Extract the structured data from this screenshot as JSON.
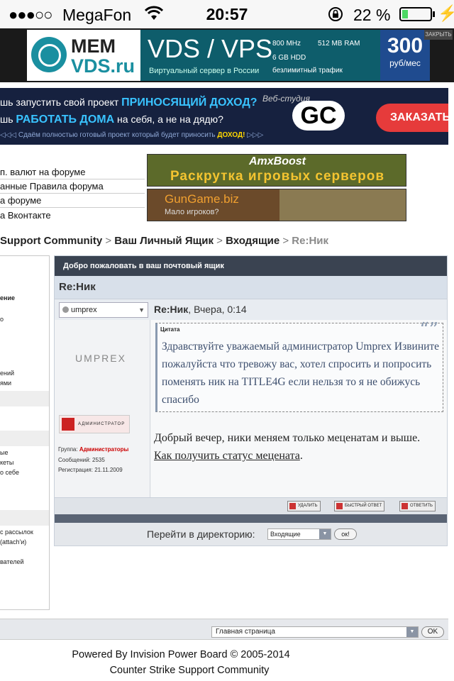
{
  "statusbar": {
    "signal": "●●●○○",
    "carrier": "MegaFon",
    "time": "20:57",
    "battery_pct": "22 %",
    "battery_level": 0.22
  },
  "ad_top": {
    "brand_line1": "MEM",
    "brand_line2": "VDS.ru",
    "headline": "VDS / VPS",
    "subline": "Виртуальный сервер в России",
    "specs": [
      "800 MHz",
      "512 MB RAM",
      "6 GB HDD",
      "безлимитный трафик"
    ],
    "price": "300",
    "price_unit": "руб/мес",
    "close_label": "ЗАКРЫТЬ"
  },
  "ad_gc": {
    "line1_a": "шь запустить свой проект ",
    "line1_b": "ПРИНОСЯЩИЙ ДОХОД?",
    "line2_a": "шь ",
    "line2_b": "РАБОТАТЬ ДОМА",
    "line2_c": " на себя, а не на дядю?",
    "line3_a": "◁◁◁ Сдаём полностью готовый проект который будет приносить ",
    "line3_b": "ДОХОД!",
    "line3_c": " ▷▷▷",
    "studio": "Веб-студия",
    "logo": "GC",
    "order_button": "ЗАКАЗАТЬ"
  },
  "top_links": [
    "п. валют на форуме",
    "анные Правила форума",
    "а форуме",
    "а Вконтакте"
  ],
  "ad_amx": {
    "title": "AmxBoost",
    "subtitle": "Раскрутка игровых серверов"
  },
  "ad_gungame": {
    "title": "GunGame.biz",
    "subtitle": "Мало игроков?"
  },
  "breadcrumb": {
    "items": [
      "Support Community",
      "Ваш Личный Ящик",
      "Входящие"
    ],
    "current": "Re:Ник",
    "separator": ">"
  },
  "sidebar": {
    "items": [
      "ение",
      "о",
      "ений",
      "ями",
      "ые",
      "кеты",
      "о себе",
      "с рассылок",
      "(attach'и)",
      "вателей"
    ]
  },
  "panel": {
    "header": "Добро пожаловать в ваш почтовый ящик",
    "subject": "Re:Ник",
    "author": "umprex",
    "post_title": "Re:Ник",
    "post_time": ", Вчера, 0:14",
    "avatar_text": "UMPREX",
    "group_badge": "АДМИНИСТРАТОР",
    "group_label": "Группа:",
    "group_value": "Администраторы",
    "posts": "Сообщений: 2535",
    "registered": "Регистрация: 21.11.2009",
    "quote_label": "Цитата",
    "quote_mark": "“”",
    "quote_text": "Здравствуйте уважаемый администратор Umprex Извините пожалуйста что тревожу вас, хотел спросить и попросить поменять ник на TITLE4G если нельзя то я не обижусь спасибо",
    "reply_text": "Добрый вечер, ники меняем только меценатам и выше.",
    "reply_link": "Как получить статус мецената",
    "reply_end": ".",
    "buttons": [
      "УДАЛИТЬ",
      "БЫСТРЫЙ ОТВЕТ",
      "ОТВЕТИТЬ"
    ],
    "goto_label": "Перейти в директорию:",
    "goto_value": "Входящие",
    "goto_ok": "ок!"
  },
  "bottom": {
    "select_value": "Главная страница",
    "ok": "OK"
  },
  "footer": {
    "line1": "Powered By Invision Power Board  © 2005-2014",
    "line2": "Counter Strike Support Community"
  },
  "colors": {
    "panel_header": "#3a4351",
    "subject_bar": "#d8e0ea",
    "admin_red": "#cc0000",
    "quote_text": "#3d4f6e",
    "battery_green": "#4cd964"
  }
}
